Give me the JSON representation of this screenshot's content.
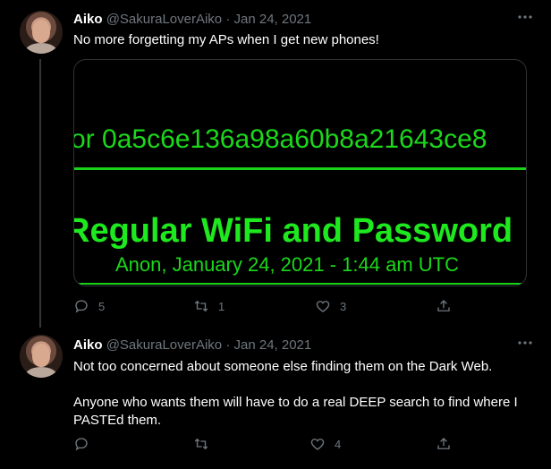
{
  "tweets": [
    {
      "name": "Aiko",
      "handle": "@SakuraLoverAiko",
      "separator": "·",
      "date": "Jan 24, 2021",
      "text": "No more forgetting my APs when I get new phones!",
      "media": {
        "hash_line": "or 0a5c6e136a98a60b8a21643ce8",
        "title_line": "Regular WiFi and Password",
        "subtitle_line": "Anon, January 24, 2021 - 1:44 am UTC"
      },
      "counts": {
        "replies": "5",
        "retweets": "1",
        "likes": "3"
      }
    },
    {
      "name": "Aiko",
      "handle": "@SakuraLoverAiko",
      "separator": "·",
      "date": "Jan 24, 2021",
      "text_p1": "Not too concerned about someone else finding them on the Dark Web.",
      "text_p2": "Anyone who wants them will have to do a real DEEP search to find where I PASTEd them.",
      "counts": {
        "replies": "",
        "retweets": "",
        "likes": "4"
      }
    }
  ],
  "icons": {
    "more": "more-icon",
    "reply": "reply-icon",
    "retweet": "retweet-icon",
    "like": "heart-icon",
    "share": "share-icon"
  },
  "colors": {
    "background": "#000000",
    "text": "#ffffff",
    "muted": "#6e767d",
    "terminal_green": "#1ee81e"
  }
}
